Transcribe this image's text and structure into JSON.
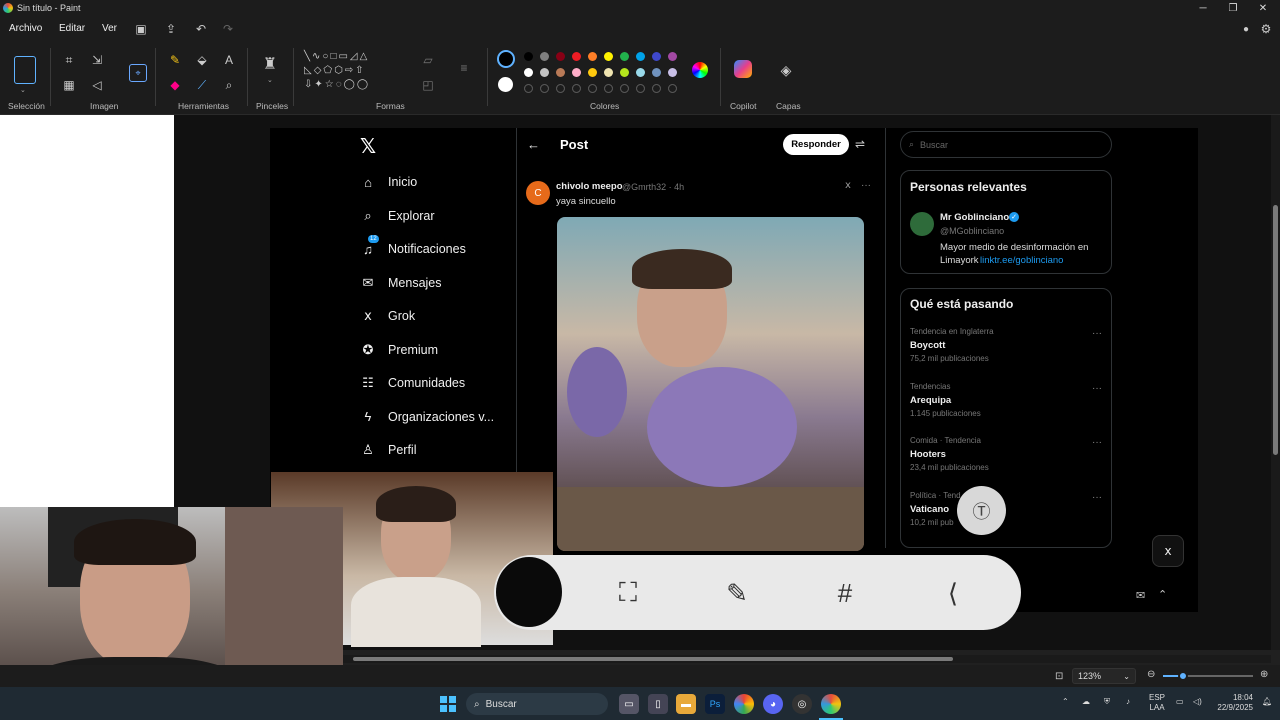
{
  "window": {
    "title": "Sin título - Paint"
  },
  "menu": {
    "file": "Archivo",
    "edit": "Editar",
    "view": "Ver"
  },
  "ribbon": {
    "groups": {
      "selection": "Selección",
      "image": "Imagen",
      "tools": "Herramientas",
      "brushes": "Pinceles",
      "shapes": "Formas",
      "colors": "Colores",
      "copilot": "Copilot",
      "layers": "Capas"
    },
    "palette_row1": [
      "#000000",
      "#7f7f7f",
      "#880015",
      "#ed1c24",
      "#ff7f27",
      "#fff200",
      "#22b14c",
      "#00a2e8",
      "#3f48cc",
      "#a349a4"
    ],
    "palette_row2": [
      "#ffffff",
      "#c3c3c3",
      "#b97a57",
      "#ffaec9",
      "#ffc90e",
      "#efe4b0",
      "#b5e61d",
      "#99d9ea",
      "#7092be",
      "#c8bfe7"
    ]
  },
  "x": {
    "nav": [
      {
        "icon": "home-icon",
        "label": "Inicio"
      },
      {
        "icon": "search-icon",
        "label": "Explorar"
      },
      {
        "icon": "bell-icon",
        "label": "Notificaciones",
        "badge": "12"
      },
      {
        "icon": "mail-icon",
        "label": "Mensajes"
      },
      {
        "icon": "grok-icon",
        "label": "Grok"
      },
      {
        "icon": "premium-icon",
        "label": "Premium"
      },
      {
        "icon": "communities-icon",
        "label": "Comunidades"
      },
      {
        "icon": "bolt-icon",
        "label": "Organizaciones v..."
      },
      {
        "icon": "person-icon",
        "label": "Perfil"
      }
    ],
    "post": {
      "header": "Post",
      "reply_button": "Responder",
      "author": "chivolo meepo",
      "handle": "@Gmrth32 · 4h",
      "text": "yaya sincuello"
    },
    "search_placeholder": "Buscar",
    "relevant": {
      "title": "Personas relevantes",
      "name": "Mr Goblinciano",
      "handle": "@MGoblinciano",
      "bio": "Mayor medio de desinformación en",
      "bio2": "Limayork",
      "link": "linktr.ee/goblinciano"
    },
    "trends_title": "Qué está pasando",
    "trends": [
      {
        "context": "Tendencia en Inglaterra",
        "name": "Boycott",
        "count": "75,2 mil publicaciones"
      },
      {
        "context": "Tendencias",
        "name": "Arequipa",
        "count": "1.145 publicaciones"
      },
      {
        "context": "Comida · Tendencia",
        "name": "Hooters",
        "count": "23,4 mil publicaciones"
      },
      {
        "context": "Política · Tend",
        "name": "Vaticano",
        "count": "10,2 mil pub"
      }
    ]
  },
  "status": {
    "zoom": "123%"
  },
  "taskbar": {
    "search": "Buscar",
    "lang1": "ESP",
    "lang2": "LAA",
    "time": "18:04",
    "date": "22/9/2025"
  }
}
